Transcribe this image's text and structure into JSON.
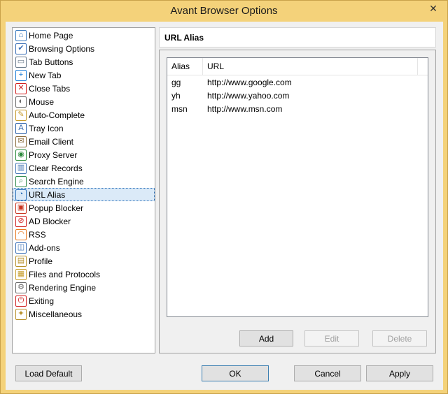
{
  "window": {
    "title": "Avant Browser Options",
    "close_glyph": "✕"
  },
  "tree": {
    "items": [
      {
        "label": "Home Page",
        "icon": "home-icon",
        "glyph": "⌂",
        "color": "#3b7bbf"
      },
      {
        "label": "Browsing Options",
        "icon": "browsing-options-icon",
        "glyph": "✔",
        "color": "#3b6fb6"
      },
      {
        "label": "Tab Buttons",
        "icon": "tab-buttons-icon",
        "glyph": "▭",
        "color": "#6b7b8c"
      },
      {
        "label": "New Tab",
        "icon": "new-tab-icon",
        "glyph": "+",
        "color": "#1e7fd8"
      },
      {
        "label": "Close Tabs",
        "icon": "close-tabs-icon",
        "glyph": "✕",
        "color": "#d02020"
      },
      {
        "label": "Mouse",
        "icon": "mouse-icon",
        "glyph": "◐",
        "color": "#6a6a6a"
      },
      {
        "label": "Auto-Complete",
        "icon": "auto-complete-icon",
        "glyph": "✎",
        "color": "#c69a2a"
      },
      {
        "label": "Tray Icon",
        "icon": "tray-icon",
        "glyph": "A",
        "color": "#2a5fa8"
      },
      {
        "label": "Email Client",
        "icon": "email-icon",
        "glyph": "✉",
        "color": "#8a6a3a"
      },
      {
        "label": "Proxy Server",
        "icon": "proxy-server-icon",
        "glyph": "◉",
        "color": "#2a8a3a"
      },
      {
        "label": "Clear Records",
        "icon": "trash-icon",
        "glyph": "▥",
        "color": "#4a7ab8"
      },
      {
        "label": "Search Engine",
        "icon": "search-engine-icon",
        "glyph": "⌕",
        "color": "#2f8a4a"
      },
      {
        "label": "URL Alias",
        "icon": "url-alias-icon",
        "glyph": "◔",
        "color": "#2a6fb8"
      },
      {
        "label": "Popup Blocker",
        "icon": "popup-blocker-icon",
        "glyph": "▣",
        "color": "#c8321e"
      },
      {
        "label": "AD Blocker",
        "icon": "ad-blocker-icon",
        "glyph": "⊘",
        "color": "#d02020"
      },
      {
        "label": "RSS",
        "icon": "rss-icon",
        "glyph": "◠",
        "color": "#e8781e"
      },
      {
        "label": "Add-ons",
        "icon": "add-ons-icon",
        "glyph": "◫",
        "color": "#3b6fb6"
      },
      {
        "label": "Profile",
        "icon": "profile-icon",
        "glyph": "▤",
        "color": "#b8902a"
      },
      {
        "label": "Files and Protocols",
        "icon": "files-protocols-icon",
        "glyph": "▦",
        "color": "#c8a030"
      },
      {
        "label": "Rendering Engine",
        "icon": "rendering-engine-icon",
        "glyph": "⚙",
        "color": "#6a6a6a"
      },
      {
        "label": "Exiting",
        "icon": "power-icon",
        "glyph": "⏻",
        "color": "#d02020"
      },
      {
        "label": "Miscellaneous",
        "icon": "miscellaneous-icon",
        "glyph": "✦",
        "color": "#b8902a"
      }
    ],
    "selected_index": 12
  },
  "panel": {
    "title": "URL Alias",
    "columns": {
      "alias": "Alias",
      "url": "URL"
    },
    "rows": [
      {
        "alias": "gg",
        "url": "http://www.google.com"
      },
      {
        "alias": "yh",
        "url": "http://www.yahoo.com"
      },
      {
        "alias": "msn",
        "url": "http://www.msn.com"
      }
    ],
    "buttons": {
      "add": "Add",
      "edit": "Edit",
      "delete": "Delete"
    }
  },
  "footer": {
    "load_default": "Load Default",
    "ok": "OK",
    "cancel": "Cancel",
    "apply": "Apply"
  }
}
